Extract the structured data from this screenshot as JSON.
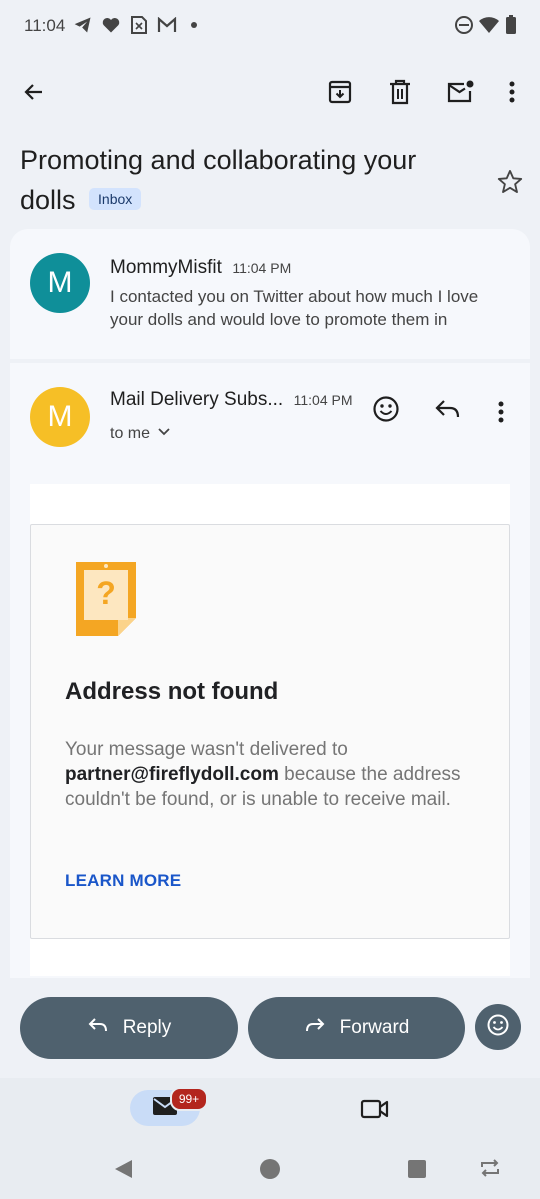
{
  "status_bar": {
    "time": "11:04",
    "left_icons": [
      "telegram-icon",
      "heart-icon",
      "sim-icon",
      "gmail-icon",
      "dot-icon"
    ],
    "right_icons": [
      "do-not-disturb-icon",
      "wifi-icon",
      "battery-icon"
    ]
  },
  "toolbar": {
    "back": "arrow-back-icon",
    "actions": [
      "archive-icon",
      "delete-icon",
      "mark-unread-icon",
      "more-vert-icon"
    ]
  },
  "subject": {
    "text": "Promoting and collaborating your dolls",
    "label": "Inbox"
  },
  "messages": [
    {
      "avatar_letter": "M",
      "avatar_color": "#0f8f99",
      "sender": "MommyMisfit",
      "time": "11:04 PM",
      "snippet": "I contacted you on Twitter about how much I love your dolls and would love to promote them in"
    },
    {
      "avatar_letter": "M",
      "avatar_color": "#f6bf26",
      "sender": "Mail Delivery Subs...",
      "time": "11:04 PM",
      "recipient": "to me"
    }
  ],
  "bounce": {
    "title": "Address not found",
    "text_before": "Your message wasn't delivered to ",
    "address": "partner@fireflydoll.com",
    "text_after": " because the address couldn't be found, or is unable to receive mail.",
    "learn_more": "LEARN MORE"
  },
  "actions": {
    "reply": "Reply",
    "forward": "Forward"
  },
  "bottom_nav": {
    "mail_badge": "99+",
    "items": [
      "mail-icon",
      "video-icon"
    ]
  },
  "colors": {
    "accent": "#1a56c9",
    "action_button": "#4f616e",
    "badge": "#b3261e"
  }
}
